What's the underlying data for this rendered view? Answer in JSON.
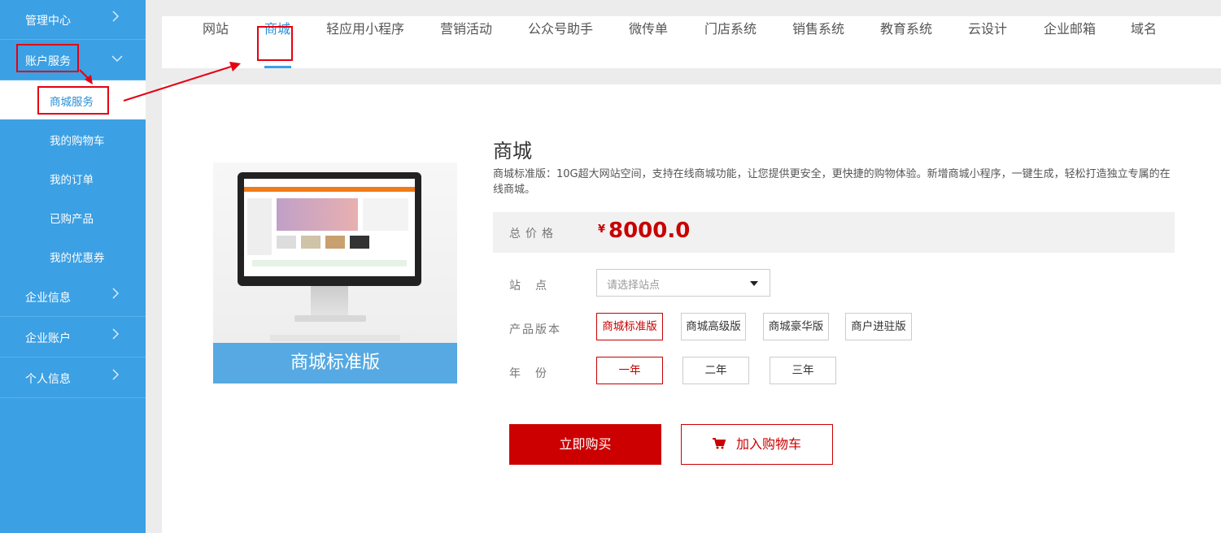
{
  "sidebar": {
    "items": [
      {
        "label": "管理中心"
      },
      {
        "label": "账户服务"
      },
      {
        "label": "企业信息"
      },
      {
        "label": "企业账户"
      },
      {
        "label": "个人信息"
      }
    ],
    "sub_items": [
      {
        "label": "商城服务"
      },
      {
        "label": "我的购物车"
      },
      {
        "label": "我的订单"
      },
      {
        "label": "已购产品"
      },
      {
        "label": "我的优惠券"
      }
    ]
  },
  "topnav": {
    "tabs": [
      {
        "label": "网站"
      },
      {
        "label": "商城"
      },
      {
        "label": "轻应用小程序"
      },
      {
        "label": "营销活动"
      },
      {
        "label": "公众号助手"
      },
      {
        "label": "微传单"
      },
      {
        "label": "门店系统"
      },
      {
        "label": "销售系统"
      },
      {
        "label": "教育系统"
      },
      {
        "label": "云设计"
      },
      {
        "label": "企业邮箱"
      },
      {
        "label": "域名"
      }
    ],
    "active_tab": "商城"
  },
  "product": {
    "image_caption": "商城标准版",
    "title": "商城",
    "description": "商城标准版：10G超大网站空间，支持在线商城功能，让您提供更安全，更快捷的购物体验。新增商城小程序，一键生成，轻松打造独立专属的在线商城。",
    "price_label": "总价格",
    "currency": "¥",
    "price": "8000.0",
    "site_label": "站　点",
    "site_placeholder": "请选择站点",
    "version_label": "产品版本",
    "versions": [
      "商城标准版",
      "商城高级版",
      "商城豪华版",
      "商户进驻版"
    ],
    "selected_version": "商城标准版",
    "year_label": "年　份",
    "years": [
      "一年",
      "二年",
      "三年"
    ],
    "selected_year": "一年",
    "buy_label": "立即购买",
    "cart_label": "加入购物车"
  },
  "colors": {
    "sidebar": "#3ca0e4",
    "accent": "#2b8fd6",
    "price": "#c80000",
    "buy_button": "#cc0000",
    "annotation": "#e60012"
  }
}
